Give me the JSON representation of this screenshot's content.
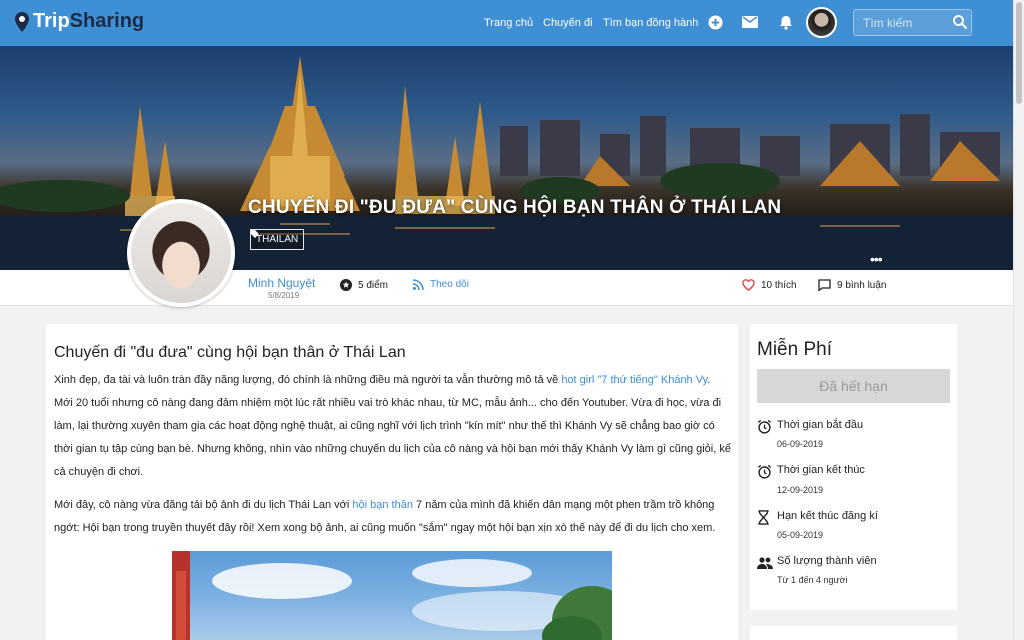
{
  "brand": {
    "trip": "Trip",
    "sharing": "Sharing"
  },
  "nav": {
    "home": "Trang chủ",
    "trips": "Chuyến đi",
    "find_companion": "Tìm bạn đồng hành",
    "search_placeholder": "Tìm kiếm"
  },
  "hero": {
    "title": "CHUYẾN ĐI \"ĐU ĐƯA\" CÙNG HỘI BẠN THÂN Ở THÁI LAN",
    "tag": "THAILAN",
    "more": "•••"
  },
  "author": {
    "name": "Minh Nguyệt",
    "date": "5/8/2019",
    "points": "5 điểm",
    "follow": "Theo dõi"
  },
  "stats": {
    "likes": "10 thích",
    "comments": "9 bình luận"
  },
  "article": {
    "heading": "Chuyến đi \"đu đưa\" cùng hội bạn thân ở Thái Lan",
    "p1_before": "Xinh đẹp, đa tài và luôn tràn đầy năng lượng, đó chính là những điều mà người ta vẫn thường mô tả về ",
    "p1_link": "hot girl \"7 thứ tiếng\" Khánh Vy",
    "p1_after": ". Mới 20 tuổi nhưng cô nàng đang đảm nhiệm một lúc rất nhiều vai trò khác nhau, từ MC, mẫu ảnh... cho đến Youtuber. Vừa đi học, vừa đi làm, lại thường xuyên tham gia các hoạt động nghệ thuật, ai cũng nghĩ với lịch trình \"kín mít\" như thế thì Khánh Vy sẽ chẳng bao giờ có thời gian tụ tập cùng bạn bè. Nhưng không, nhìn vào những chuyến du lịch của cô nàng và hội bạn mới thấy Khánh Vy làm gì cũng giỏi, kể cả chuyện đi chơi.",
    "p2_before": "Mới đây, cô nàng vừa đăng tải bộ ảnh đi du lịch Thái Lan với ",
    "p2_link": "hội bạn thân",
    "p2_after": " 7 năm của mình đã khiến dân mạng một phen trầm trồ không ngớt: Hội bạn trong truyền thuyết đây rồi! Xem xong bộ ảnh, ai cũng muốn \"sắm\" ngay một hội bạn xịn xò thế này để đi du lịch cho xem."
  },
  "sidebar": {
    "price": "Miễn Phí",
    "status_button": "Đã hết hạn",
    "items": [
      {
        "icon": "alarm-clock-icon",
        "label": "Thời gian bắt đầu",
        "value": "06-09-2019"
      },
      {
        "icon": "alarm-clock-icon",
        "label": "Thời gian kết thúc",
        "value": "12-09-2019"
      },
      {
        "icon": "hourglass-icon",
        "label": "Hạn kết thúc đăng kí",
        "value": "05-09-2019"
      },
      {
        "icon": "group-icon",
        "label": "Số lượng thành viên",
        "value": "Từ 1 đến 4 người"
      }
    ]
  },
  "colors": {
    "primary": "#3e8fd4",
    "like": "#e0454b"
  }
}
